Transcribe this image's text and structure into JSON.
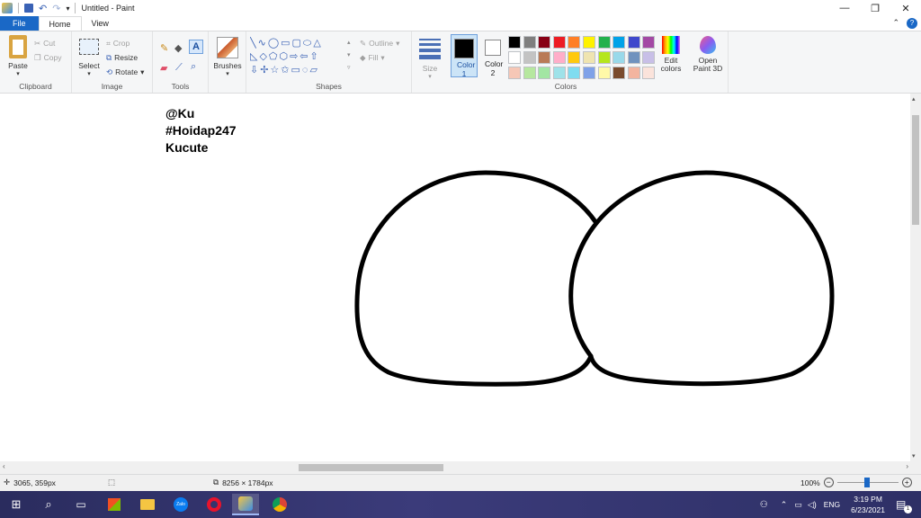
{
  "window": {
    "title": "Untitled - Paint"
  },
  "tabs": {
    "file": "File",
    "home": "Home",
    "view": "View"
  },
  "clipboard": {
    "paste": "Paste",
    "cut": "Cut",
    "copy": "Copy",
    "label": "Clipboard"
  },
  "image": {
    "select": "Select",
    "crop": "Crop",
    "resize": "Resize",
    "rotate": "Rotate",
    "label": "Image"
  },
  "tools": {
    "label": "Tools"
  },
  "brushes": {
    "label": "Brushes"
  },
  "shapes": {
    "outline": "Outline",
    "fill": "Fill",
    "label": "Shapes"
  },
  "size": {
    "label": "Size"
  },
  "colors": {
    "color1": "Color 1",
    "color2": "Color 2",
    "label": "Colors",
    "edit": "Edit colors",
    "open3d": "Open Paint 3D",
    "color1_value": "#000000",
    "color2_value": "#ffffff",
    "palette_row1": [
      "#000000",
      "#7f7f7f",
      "#880015",
      "#ed1c24",
      "#ff7f27",
      "#fff200",
      "#22b14c",
      "#00a2e8",
      "#3f48cc",
      "#a349a4"
    ],
    "palette_row2": [
      "#ffffff",
      "#c3c3c3",
      "#b97a57",
      "#ffaec9",
      "#ffc90e",
      "#efe4b0",
      "#b5e61d",
      "#99d9ea",
      "#7092be",
      "#c8bfe7"
    ],
    "palette_row3": [
      "#f6c7b6",
      "#b6e79f",
      "#a2e6a3",
      "#9fe2e9",
      "#7fdcf0",
      "#7fa1e8",
      "#fff9a8",
      "#7a4b2e",
      "#f3b49f",
      "#fbe3db"
    ]
  },
  "canvas": {
    "text_lines": [
      "@Ku",
      "#Hoidap247",
      "Kucute"
    ]
  },
  "status": {
    "position": "3065, 359px",
    "dimensions": "8256 × 1784px",
    "zoom": "100%"
  },
  "taskbar": {
    "lang": "ENG",
    "time": "3:19 PM",
    "date": "6/23/2021",
    "notif_count": "1"
  }
}
